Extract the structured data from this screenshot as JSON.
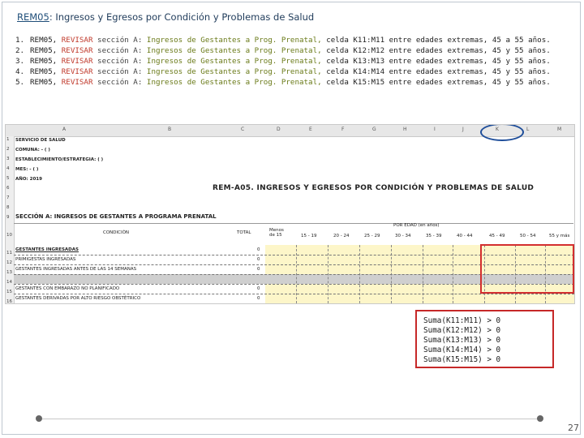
{
  "title": {
    "link": "REM05",
    "rest": ": Ingresos y Egresos por Condición y Problemas de Salud"
  },
  "checks": [
    {
      "num": "1.",
      "code": "REM05,",
      "rev": "REVISAR",
      "sec": "sección A:",
      "sheet": "Ingresos de Gestantes a Prog. Prenatal,",
      "tail": "celda K11:M11 entre edades extremas, 45 a 55 años."
    },
    {
      "num": "2.",
      "code": "REM05,",
      "rev": "REVISAR",
      "sec": "sección A:",
      "sheet": "Ingresos de Gestantes a Prog. Prenatal,",
      "tail": "celda K12:M12 entre edades extremas, 45 y 55 años."
    },
    {
      "num": "3.",
      "code": "REM05,",
      "rev": "REVISAR",
      "sec": "sección A:",
      "sheet": "Ingresos de Gestantes a Prog. Prenatal,",
      "tail": "celda K13:M13 entre edades extremas, 45 y 55 años."
    },
    {
      "num": "4.",
      "code": "REM05,",
      "rev": "REVISAR",
      "sec": "sección A:",
      "sheet": "Ingresos de Gestantes a Prog. Prenatal,",
      "tail": "celda K14:M14 entre edades extremas, 45 y 55 años."
    },
    {
      "num": "5.",
      "code": "REM05,",
      "rev": "REVISAR",
      "sec": "sección A:",
      "sheet": "Ingresos de Gestantes a Prog. Prenatal,",
      "tail": "celda K15:M15 entre edades extremas, 45 y 55 años."
    }
  ],
  "sheet": {
    "columns": [
      "A",
      "B",
      "C",
      "D",
      "E",
      "F",
      "G",
      "H",
      "I",
      "J",
      "K",
      "L",
      "M"
    ],
    "rows": [
      "1",
      "2",
      "3",
      "4",
      "5",
      "6",
      "7",
      "8",
      "9",
      "10",
      "11",
      "12",
      "13",
      "14",
      "15",
      "16"
    ],
    "header_lines": [
      "SERVICIO DE SALUD",
      "COMUNA: - ( )",
      "ESTABLECIMIENTO/ESTRATEGIA: ( )",
      "MES: - ( )",
      "AÑO: 2019"
    ],
    "report_title": "REM-A05. INGRESOS Y EGRESOS POR CONDICIÓN Y PROBLEMAS DE SALUD",
    "section_title": "SECCIÓN A: INGRESOS DE GESTANTES A PROGRAMA PRENATAL",
    "col_condicion": "CONDICIÓN",
    "col_total": "TOTAL",
    "age_group_label": "POR EDAD (en años)",
    "age_cols": [
      "Menos de 15",
      "15 - 19",
      "20 - 24",
      "25 - 29",
      "30 - 34",
      "35 - 39",
      "40 - 44",
      "45 - 49",
      "50 - 54",
      "55 y más"
    ],
    "data_rows": [
      {
        "label": "GESTANTES INGRESADAS",
        "total": "0"
      },
      {
        "label": "PRIMIGESTAS INGRESADAS",
        "total": "0"
      },
      {
        "label": "GESTANTES INGRESADAS ANTES DE LAS 14 SEMANAS",
        "total": "0"
      },
      {
        "label": "GESTANTES CON EMBARAZO NO PLANIFICADO",
        "total": "0"
      },
      {
        "label": "GESTANTES DERIVADAS POR ALTO RIESGO OBSTÉTRICO",
        "total": "0"
      }
    ]
  },
  "formulas": [
    "Suma(K11:M11) > 0",
    "Suma(K12:M12) > 0",
    "Suma(K13:M13) > 0",
    "Suma(K14:M14) > 0",
    "Suma(K15:M15) > 0"
  ],
  "page_number": "27",
  "colors": {
    "highlight_red": "#d32f2f",
    "ellipse_blue": "#1f4e9a",
    "cell_yellow": "#fdf6c9"
  }
}
